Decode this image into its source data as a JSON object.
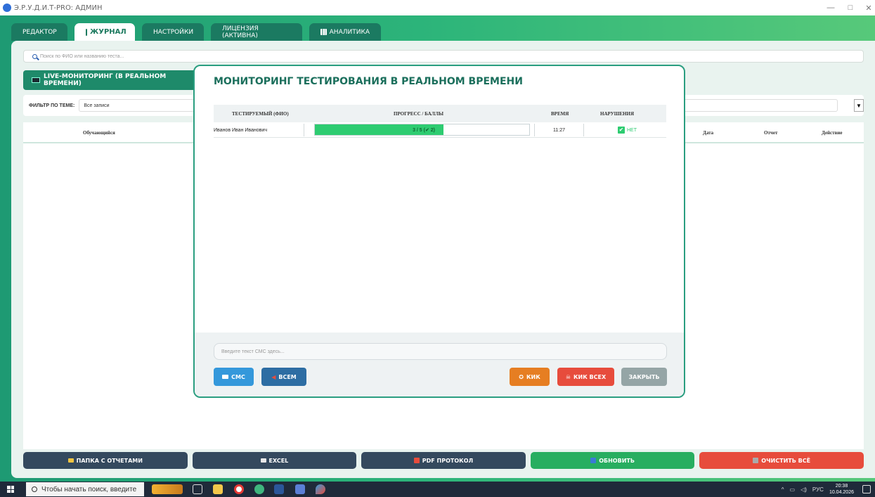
{
  "window": {
    "title": "Э.Р.У.Д.И.Т-PRO: АДМИН",
    "minimize": "—",
    "maximize": "□",
    "close": "✕"
  },
  "tabs": [
    {
      "label": "РЕДАКТОР"
    },
    {
      "label": "ЖУРНАЛ"
    },
    {
      "label": "НАСТРОЙКИ"
    },
    {
      "label": "ЛИЦЕНЗИЯ (АКТИВНА)"
    },
    {
      "label": "АНАЛИТИКА"
    }
  ],
  "search": {
    "placeholder": "Поиск по ФИО или названию теста..."
  },
  "live_banner": "LIVE-МОНИТОРИНГ (В РЕАЛЬНОМ ВРЕМЕНИ)",
  "filter": {
    "label": "ФИЛЬТР ПО ТЕМЕ:",
    "value": "Все записи",
    "arrow": "▼"
  },
  "journal_table": {
    "columns": [
      "Обучающийся",
      "Дата",
      "Отчет",
      "Действие"
    ]
  },
  "bottom_buttons": [
    {
      "label": "ПАПКА С ОТЧЕТАМИ",
      "color": "#34495e"
    },
    {
      "label": "EXCEL",
      "color": "#34495e"
    },
    {
      "label": "PDF ПРОТОКОЛ",
      "color": "#34495e"
    },
    {
      "label": "ОБНОВИТЬ",
      "color": "#27ae60"
    },
    {
      "label": "ОЧИСТИТЬ ВСЁ",
      "color": "#e74c3c"
    }
  ],
  "modal": {
    "title": "МОНИТОРИНГ ТЕСТИРОВАНИЯ В РЕАЛЬНОМ ВРЕМЕНИ",
    "columns": {
      "name": "ТЕСТИРУЕМЫЙ (ФИО)",
      "progress": "ПРОГРЕСС / БАЛЛЫ",
      "time": "ВРЕМЯ",
      "violations": "НАРУШЕНИЯ"
    },
    "rows": [
      {
        "name": "Иванов Иван Иванович",
        "progress_text": "3 / 5 (✔ 2)",
        "progress_fraction": 0.6,
        "time": "11:27",
        "violations": "НЕТ"
      }
    ],
    "sms_placeholder": "Введите текст СМС здесь...",
    "buttons": {
      "sms": "СМС",
      "all": "ВСЕМ",
      "kick": "КИК",
      "kick_all": "КИК ВСЕХ",
      "close": "ЗАКРЫТЬ"
    }
  },
  "taskbar": {
    "search_placeholder": "Чтобы начать поиск, введите",
    "language": "РУС",
    "time": "20:38",
    "date": "10.04.2026"
  }
}
